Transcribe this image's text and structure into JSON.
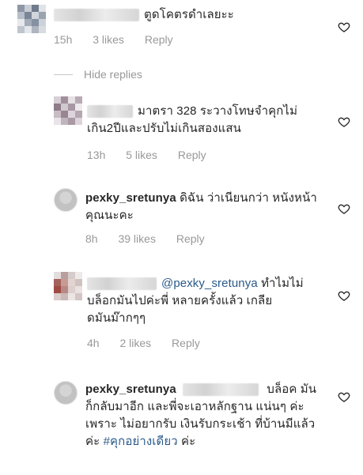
{
  "comments": [
    {
      "text": "ตูดโคตรดำเลยะะ",
      "time": "15h",
      "likes": "3 likes",
      "reply": "Reply"
    },
    {
      "text": "มาตรา 328 ระวางโทษจำคุกไม่เกิน2ปีและปรับไม่เกินสองแสน",
      "time": "13h",
      "likes": "5 likes",
      "reply": "Reply"
    },
    {
      "username": "pexky_sretunya",
      "text": "ดิฉัน ว่าเนียนกว่า หนังหน้าคุณนะคะ",
      "time": "8h",
      "likes": "39 likes",
      "reply": "Reply"
    },
    {
      "mention": "@pexky_sretunya",
      "text": "ทำไมไม่บล็อกมันไปค่ะพี่ หลายครั้งแล้ว เกลียดมันม๊ากๆๆ",
      "time": "4h",
      "likes": "2 likes",
      "reply": "Reply"
    },
    {
      "username": "pexky_sretunya",
      "text": "บล็อค มันก็กลับมาอีก และพี่จะเอาหลักฐาน แน่นๆ ค่ะ  เพราะ ไม่อยากรับ เงินรับกระเช้า ที่บ้านมีแล้วค่ะ",
      "hashtag": "#คุกอย่างเดียว",
      "text_end": "ค่ะ"
    }
  ],
  "hide_replies": "Hide replies",
  "colors": {
    "meta": "#999999",
    "mention": "#2b5a8a",
    "text": "#262626"
  }
}
